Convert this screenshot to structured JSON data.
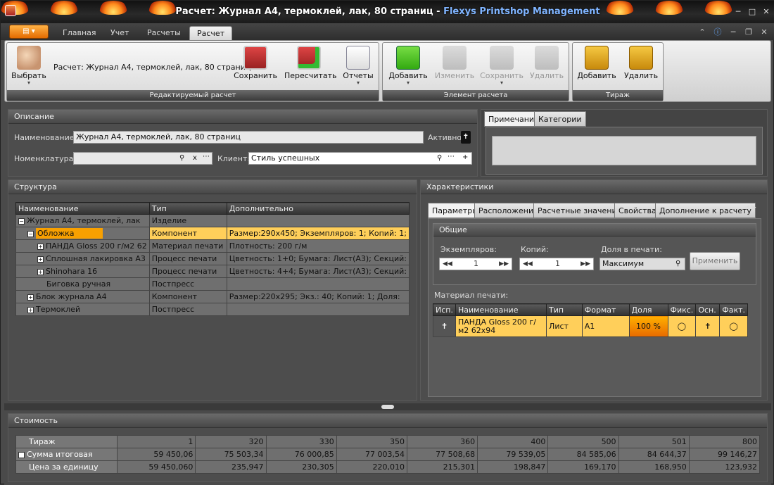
{
  "window": {
    "title": "Расчет: Журнал А4, термоклей, лак, 80 страниц",
    "title_sep": " - ",
    "brand": "Flexys Printshop Management"
  },
  "ribbon_tabs": [
    "Главная",
    "Учет",
    "Расчеты",
    "Расчет"
  ],
  "ribbon": {
    "select_label": "Выбрать",
    "current_calc": "Расчет: Журнал А4, термоклей, лак, 80 страниц",
    "save_label": "Сохранить",
    "recalc_label": "Пересчитать",
    "reports_label": "Отчеты",
    "group1_label": "Редактируемый расчет",
    "el_add": "Добавить",
    "el_edit": "Изменить",
    "el_save": "Сохранить",
    "el_delete": "Удалить",
    "group2_label": "Элемент расчета",
    "run_add": "Добавить",
    "run_delete": "Удалить",
    "group3_label": "Тираж"
  },
  "description": {
    "header": "Описание",
    "name_label": "Наименование:",
    "name_value": "Журнал А4, термоклей, лак, 80 страниц",
    "active_label": "Активно",
    "nomen_label": "Номенклатура:",
    "nomen_value": "",
    "nomen_x": "x",
    "client_label": "Клиент:",
    "client_value": "Стиль успешных",
    "client_plus": "+"
  },
  "notes": {
    "tab_note": "Примечание",
    "tab_categories": "Категории"
  },
  "structure": {
    "header": "Структура",
    "columns": [
      "Наименование",
      "Тип",
      "Дополнительно"
    ],
    "rows": [
      {
        "name": "Журнал А4, термоклей, лак",
        "type": "Изделие",
        "extra": ""
      },
      {
        "name": "Обложка",
        "type": "Компонент",
        "extra": "Размер:290x450; Экземпляров: 1; Копий: 1;"
      },
      {
        "name": "ПАНДА Gloss 200 г/м2 62",
        "type": "Материал печати",
        "extra": "Плотность: 200 г/м"
      },
      {
        "name": "Сплошная лакировка А3",
        "type": "Процесс печати",
        "extra": "Цветность: 1+0; Бумага: Лист(А3); Секций:"
      },
      {
        "name": "Shinohara 16",
        "type": "Процесс печати",
        "extra": "Цветность: 4+4; Бумага: Лист(А3); Секций:"
      },
      {
        "name": "Биговка ручная",
        "type": "Постпресс",
        "extra": ""
      },
      {
        "name": "Блок журнала А4",
        "type": "Компонент",
        "extra": "Размер:220x295; Экз.: 40; Копий: 1; Доля:"
      },
      {
        "name": "Термоклей",
        "type": "Постпресс",
        "extra": ""
      }
    ]
  },
  "characteristics": {
    "header": "Характеристики",
    "tabs": [
      "Параметры",
      "Расположение",
      "Расчетные значения",
      "Свойства",
      "Дополнение к расчету"
    ],
    "general_header": "Общие",
    "copies_label": "Экземпляров:",
    "copies_value": "1",
    "kopii_label": "Копий:",
    "kopii_value": "1",
    "share_label": "Доля в печати:",
    "share_value": "Максимум",
    "apply_label": "Применить",
    "material_label": "Материал печати:",
    "mat_columns": [
      "Исп.",
      "Наименование",
      "Тип",
      "Формат",
      "Доля",
      "Фикс.",
      "Осн.",
      "Факт."
    ],
    "mat_row": {
      "name": "ПАНДА Gloss 200 г/м2 62x94",
      "type": "Лист",
      "format": "А1",
      "share": "100 %"
    }
  },
  "cost": {
    "header": "Стоимость",
    "row_labels": [
      "Тираж",
      "Сумма итоговая",
      "Цена за единицу"
    ],
    "tiraz": [
      "1",
      "320",
      "330",
      "350",
      "360",
      "400",
      "500",
      "501",
      "800"
    ],
    "sum": [
      "59 450,06",
      "75 503,34",
      "76 000,85",
      "77 003,54",
      "77 508,68",
      "79 539,05",
      "84 585,06",
      "84 644,37",
      "99 146,27"
    ],
    "unit": [
      "59 450,060",
      "235,947",
      "230,305",
      "220,010",
      "215,301",
      "198,847",
      "169,170",
      "168,950",
      "123,932"
    ]
  }
}
